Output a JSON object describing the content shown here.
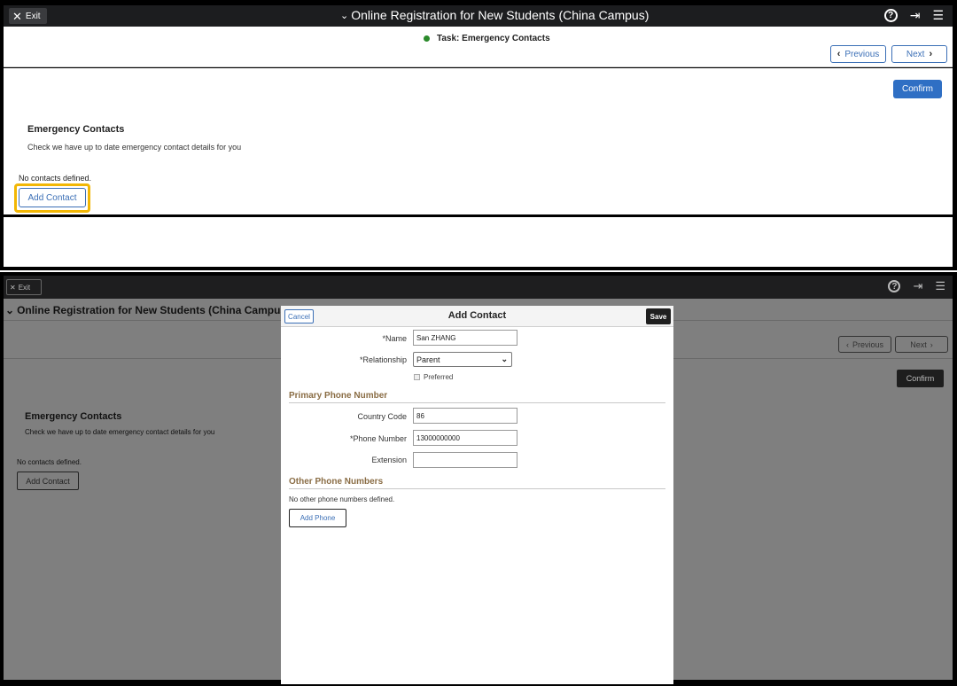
{
  "top": {
    "exit_label": "Exit",
    "title": "Online Registration for New Students (China Campus)",
    "task_label": "Task: Emergency Contacts",
    "prev_label": "Previous",
    "next_label": "Next",
    "confirm_label": "Confirm",
    "section_title": "Emergency Contacts",
    "section_desc": "Check we have up to date emergency contact details for you",
    "no_contacts": "No contacts defined.",
    "add_contact_label": "Add Contact"
  },
  "bottom": {
    "exit_label": "Exit",
    "title": "Online Registration for New Students (China Campus)",
    "prev_label": "Previous",
    "next_label": "Next",
    "confirm_label": "Confirm",
    "section_title": "Emergency Contacts",
    "section_desc": "Check we have up to date emergency contact details for you",
    "no_contacts": "No contacts defined.",
    "add_contact_label": "Add Contact"
  },
  "modal": {
    "cancel_label": "Cancel",
    "title": "Add Contact",
    "save_label": "Save",
    "name_label": "*Name",
    "name_value": "San ZHANG",
    "relationship_label": "*Relationship",
    "relationship_value": "Parent",
    "preferred_label": "Preferred",
    "primary_phone_heading": "Primary Phone Number",
    "country_code_label": "Country Code",
    "country_code_value": "86",
    "phone_number_label": "*Phone Number",
    "phone_number_value": "13000000000",
    "extension_label": "Extension",
    "extension_value": "",
    "other_phones_heading": "Other Phone Numbers",
    "no_other_phones": "No other phone numbers defined.",
    "add_phone_label": "Add Phone"
  },
  "icons": {
    "help": "help-circle-icon",
    "signout": "sign-out-icon",
    "menu": "hamburger-menu-icon"
  },
  "colors": {
    "accent_blue": "#2f6fc4",
    "highlight": "#f2b705",
    "task_dot": "#2b8a2b",
    "section_heading": "#8a6d45"
  }
}
